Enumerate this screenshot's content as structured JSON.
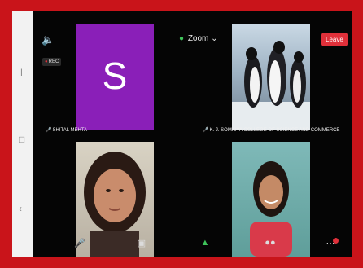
{
  "app": {
    "title": "Zoom",
    "leave_label": "Leave",
    "rec_label": "REC"
  },
  "participants": [
    {
      "name": "SHITAL MEHTA",
      "avatar_letter": "S"
    },
    {
      "name": "K. J. SOMAIYA COLLEGE OF SCIENCE AND COMMERCE"
    }
  ],
  "icons": {
    "speaker": "speaker-icon",
    "shield": "shield-icon",
    "chevron": "chevron-down-icon",
    "mic": "microphone-icon"
  },
  "colors": {
    "frame": "#c9141a",
    "leave": "#e0303a",
    "avatar_bg": "#8a1fb8",
    "shield": "#3ec45a"
  }
}
